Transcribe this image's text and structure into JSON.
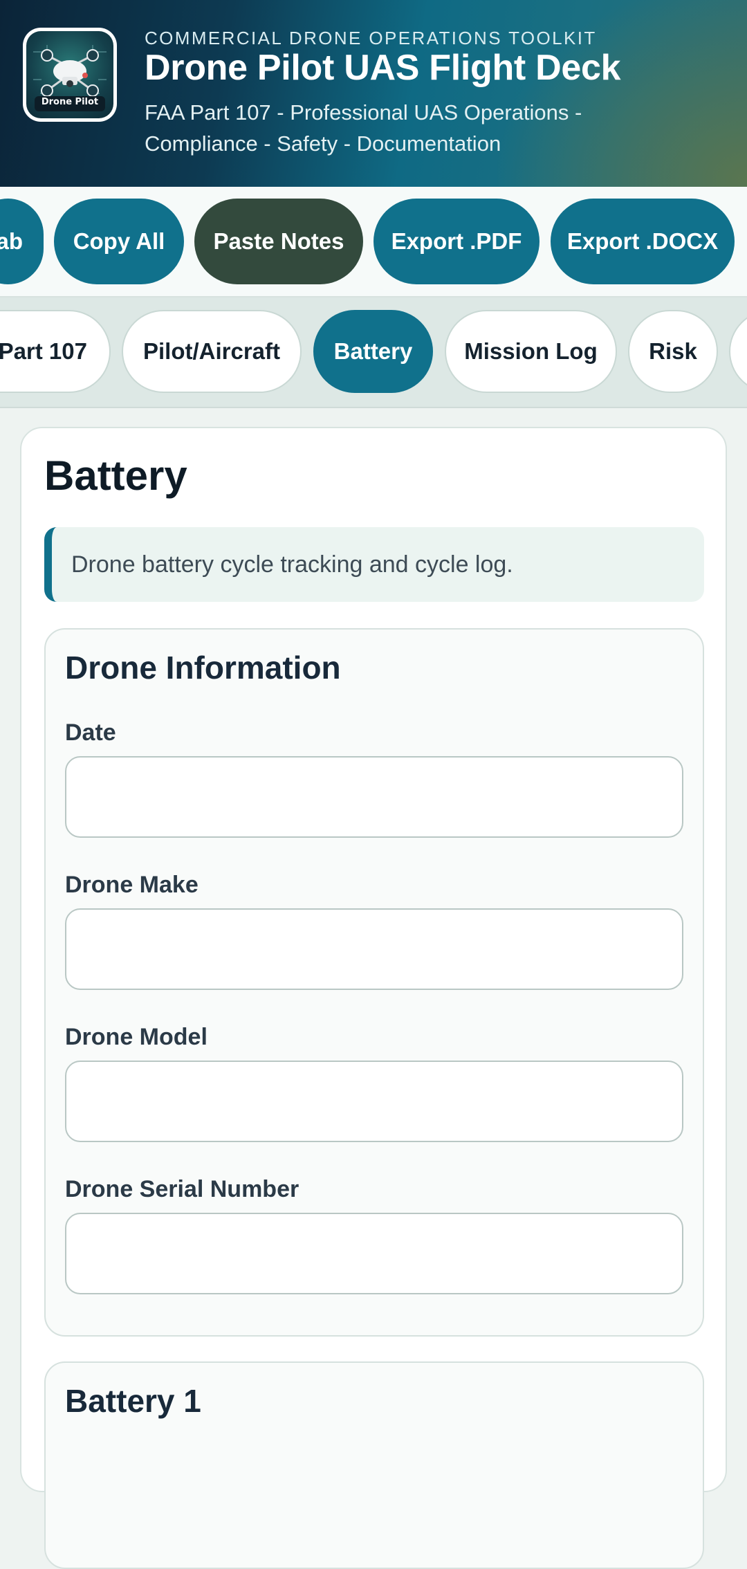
{
  "header": {
    "eyebrow": "COMMERCIAL DRONE OPERATIONS TOOLKIT",
    "title": "Drone Pilot UAS Flight Deck",
    "subtitle": "FAA Part 107 - Professional UAS Operations - Compliance - Safety - Documentation",
    "logo_text": "Drone Pilot"
  },
  "actions": [
    {
      "label": "ab"
    },
    {
      "label": "Copy All"
    },
    {
      "label": "Paste Notes"
    },
    {
      "label": "Export .PDF"
    },
    {
      "label": "Export .DOCX"
    }
  ],
  "tabs": [
    {
      "label": "Part 107",
      "active": false
    },
    {
      "label": "Pilot/Aircraft",
      "active": false
    },
    {
      "label": "Battery",
      "active": true
    },
    {
      "label": "Mission Log",
      "active": false
    },
    {
      "label": "Risk",
      "active": false
    },
    {
      "label": "",
      "active": false
    }
  ],
  "page": {
    "title": "Battery",
    "description": "Drone battery cycle tracking and cycle log."
  },
  "sections": {
    "drone_info": {
      "title": "Drone Information",
      "fields": [
        {
          "label": "Date",
          "value": "",
          "placeholder": ""
        },
        {
          "label": "Drone Make",
          "value": "",
          "placeholder": ""
        },
        {
          "label": "Drone Model",
          "value": "",
          "placeholder": ""
        },
        {
          "label": "Drone Serial Number",
          "value": "",
          "placeholder": ""
        }
      ]
    },
    "battery_1": {
      "title": "Battery 1"
    }
  },
  "colors": {
    "accent": "#10718c",
    "accent_dark": "#334a3d",
    "header_start": "#0b2438",
    "header_end": "#5c764e"
  }
}
